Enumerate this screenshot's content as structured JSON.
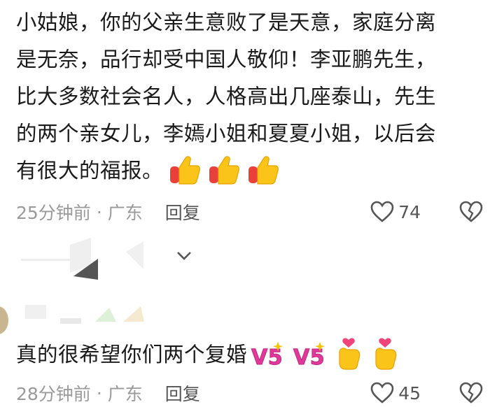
{
  "comments": [
    {
      "lines": [
        "小姑娘，你的父亲生意败了是天意，家庭分离",
        "是无奈，品行却受中国人敬仰！李亚鹏先生，",
        "比大多数社会名人，人格高出几座泰山，先生",
        "的两个亲女儿，李嫣小姐和夏夏小姐，以后会",
        "有很大的福报。"
      ],
      "emojis": [
        "thumbs-up",
        "thumbs-up",
        "thumbs-up"
      ],
      "time": "25分钟前",
      "separator": "·",
      "location": "广东",
      "reply_label": "回复",
      "like_count": "74"
    },
    {
      "lines": [
        "真的很希望你们两个复婚"
      ],
      "emojis": [
        "v5-sticker",
        "v5-sticker",
        "finger-heart",
        "finger-heart"
      ],
      "time": "28分钟前",
      "separator": "·",
      "location": "广东",
      "reply_label": "回复",
      "like_count": "45"
    }
  ],
  "colors": {
    "meta": "#9a9a9a",
    "text": "#1a1a1a",
    "v5": "#e0399a",
    "thumb": "#f5b800"
  }
}
